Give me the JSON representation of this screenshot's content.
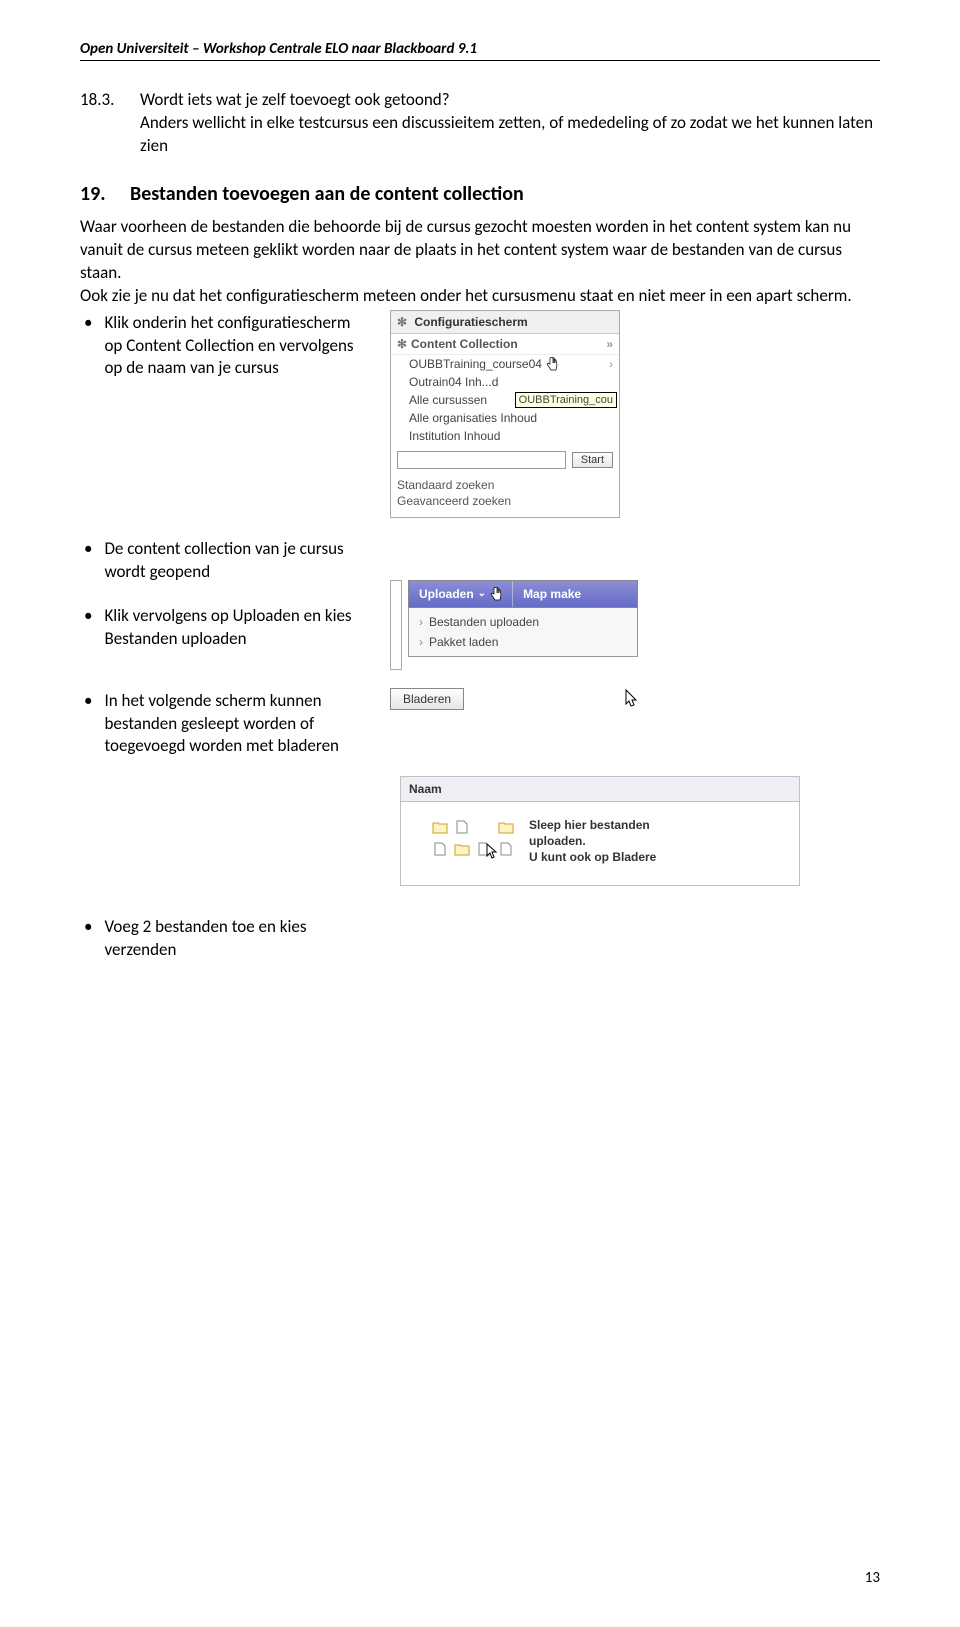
{
  "header": "Open Universiteit – Workshop Centrale ELO naar Blackboard 9.1",
  "para_18_3": {
    "num": "18.3.",
    "text": "Wordt iets wat je zelf toevoegt ook getoond?\nAnders wellicht in elke testcursus een discussieitem zetten, of mededeling of zo zodat we het kunnen laten zien"
  },
  "h19": {
    "num": "19.",
    "title": "Bestanden toevoegen aan de content collection"
  },
  "intro": "Waar voorheen de bestanden die behoorde bij de cursus gezocht moesten worden in het content system kan nu vanuit de cursus meteen geklikt worden naar de plaats in het content system waar de bestanden van de cursus staan.\nOok zie je nu dat het configuratiescherm meteen onder het cursusmenu staat en niet meer in een apart scherm.",
  "bullets": {
    "b1": "Klik onderin het configuratiescherm op Content Collection en vervolgens op de naam van je cursus",
    "b2": "De content collection van je cursus wordt geopend",
    "b3": "Klik vervolgens op Uploaden en kies Bestanden uploaden",
    "b4": "In het volgende scherm kunnen bestanden gesleept worden of toegevoegd worden met bladeren",
    "b5": "Voeg 2 bestanden toe en kies verzenden"
  },
  "config_panel": {
    "title": "Configuratiescherm",
    "cc": "Content Collection",
    "items": {
      "i0": "OUBBTraining_course04",
      "i1": "Outrain04 Inh...d",
      "i2": "Alle cursussen",
      "i2_tip": "OUBBTraining_cou",
      "i3": "Alle organisaties Inhoud",
      "i4": "Institution Inhoud"
    },
    "start_btn": "Start",
    "std_search": "Standaard zoeken",
    "adv_search": "Geavanceerd zoeken"
  },
  "upload": {
    "upload_label": "Uploaden",
    "map_label": "Map make",
    "mi1": "Bestanden uploaden",
    "mi2": "Pakket laden"
  },
  "bladeren_btn": "Bladeren",
  "naam": {
    "header": "Naam",
    "drop_text_1": "Sleep hier bestanden",
    "drop_text_2": "uploaden.",
    "drop_text_3": "U kunt ook op Bladere"
  },
  "page_num": "13"
}
